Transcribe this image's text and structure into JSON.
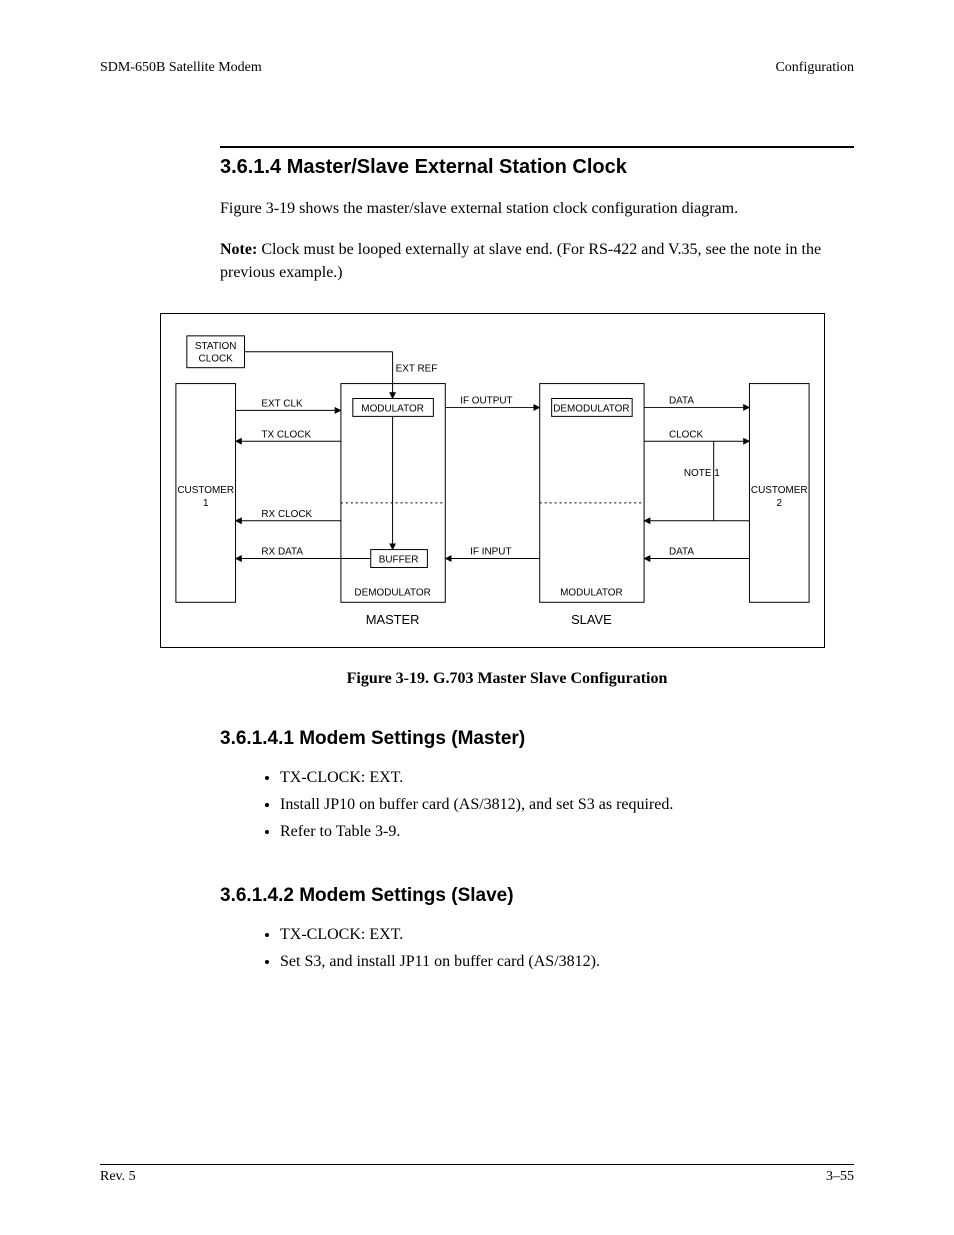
{
  "header": {
    "left": "SDM-650B Satellite Modem",
    "right": "Configuration"
  },
  "section": {
    "number_title": "3.6.1.4  Master/Slave External Station Clock",
    "para1": "Figure 3-19 shows the master/slave external station clock configuration diagram.",
    "note_label": "Note:",
    "note_text": " Clock must be looped externally at slave end. (For RS-422 and V.35, see the note in the previous example.)"
  },
  "figure": {
    "labels": {
      "station_clock1": "STATION",
      "station_clock2": "CLOCK",
      "ext_ref": "EXT REF",
      "ext_clk": "EXT CLK",
      "modulator": "MODULATOR",
      "if_output": "IF OUTPUT",
      "demodulator_top": "DEMODULATOR",
      "data_top": "DATA",
      "tx_clock": "TX CLOCK",
      "clock": "CLOCK",
      "note1": "NOTE 1",
      "customer1a": "CUSTOMER",
      "customer1b": "1",
      "customer2a": "CUSTOMER",
      "customer2b": "2",
      "rx_clock": "RX CLOCK",
      "rx_data": "RX DATA",
      "buffer": "BUFFER",
      "if_input": "IF INPUT",
      "data_bot": "DATA",
      "demodulator_bot": "DEMODULATOR",
      "modulator_bot": "MODULATOR",
      "master": "MASTER",
      "slave": "SLAVE"
    },
    "caption": "Figure 3-19.  G.703 Master Slave Configuration"
  },
  "sub1": {
    "title": "3.6.1.4.1  Modem Settings (Master)",
    "items": [
      "TX-CLOCK: EXT.",
      "Install JP10 on buffer card (AS/3812), and set S3 as required.",
      "Refer to Table 3-9."
    ]
  },
  "sub2": {
    "title": "3.6.1.4.2  Modem Settings (Slave)",
    "items": [
      "TX-CLOCK: EXT.",
      "Set S3, and install JP11 on buffer card (AS/3812)."
    ]
  },
  "footer": {
    "left": "Rev. 5",
    "right": "3–55"
  }
}
